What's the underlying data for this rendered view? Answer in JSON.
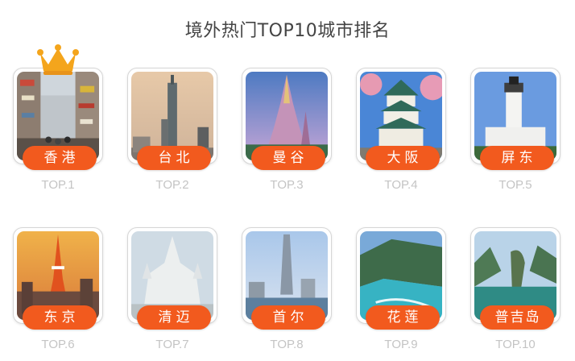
{
  "title": "境外热门TOP10城市排名",
  "colors": {
    "accent": "#f25a1e",
    "rank_text": "#c4c4c4",
    "crown": "#f4a51c"
  },
  "crown_icon": "crown-icon",
  "cities": [
    {
      "name": "香港",
      "rank": "TOP.1"
    },
    {
      "name": "台北",
      "rank": "TOP.2"
    },
    {
      "name": "曼谷",
      "rank": "TOP.3"
    },
    {
      "name": "大阪",
      "rank": "TOP.4"
    },
    {
      "name": "屏东",
      "rank": "TOP.5"
    },
    {
      "name": "东京",
      "rank": "TOP.6"
    },
    {
      "name": "清迈",
      "rank": "TOP.7"
    },
    {
      "name": "首尔",
      "rank": "TOP.8"
    },
    {
      "name": "花莲",
      "rank": "TOP.9"
    },
    {
      "name": "普吉岛",
      "rank": "TOP.10"
    }
  ]
}
